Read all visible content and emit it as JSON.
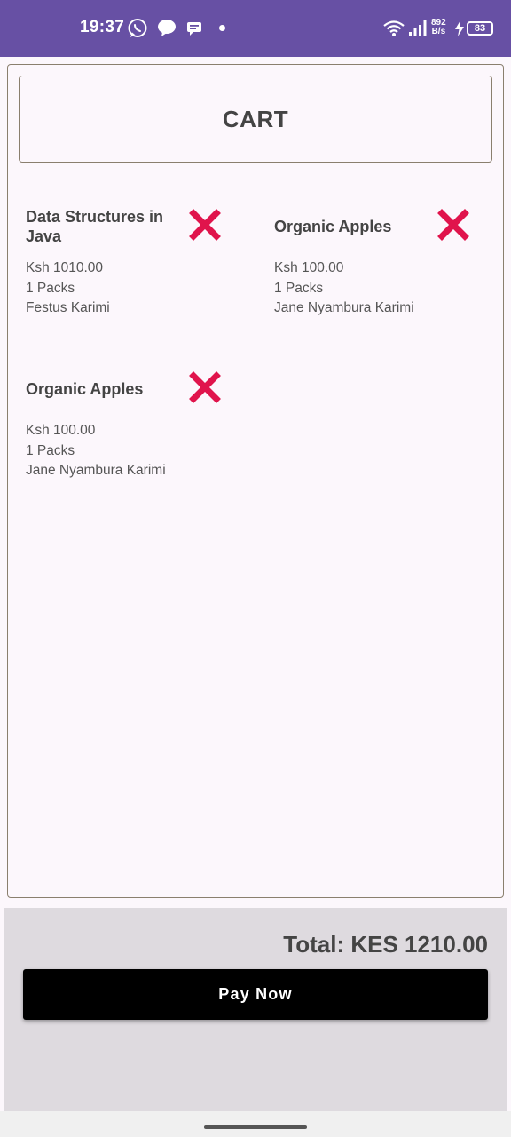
{
  "status_bar": {
    "time": "19:37",
    "net_speed_value": "892",
    "net_speed_unit": "B/s",
    "battery": "83",
    "icons": [
      "whatsapp-icon",
      "chat-bubble-icon",
      "message-icon",
      "notification-dot",
      "wifi-icon",
      "signal-icon",
      "charging-icon",
      "battery-icon"
    ]
  },
  "cart": {
    "title": "CART",
    "items": [
      {
        "name": "Data Structures in Java",
        "price": "Ksh 1010.00",
        "quantity": "1 Packs",
        "seller": "Festus Karimi",
        "remove_icon": "close-x-icon"
      },
      {
        "name": "Organic Apples",
        "price": "Ksh 100.00",
        "quantity": "1 Packs",
        "seller": "Jane Nyambura Karimi",
        "remove_icon": "close-x-icon"
      },
      {
        "name": "Organic Apples",
        "price": "Ksh 100.00",
        "quantity": "1 Packs",
        "seller": "Jane Nyambura Karimi",
        "remove_icon": "close-x-icon"
      }
    ]
  },
  "footer": {
    "total": "Total: KES 1210.00",
    "pay_label": "Pay Now"
  },
  "colors": {
    "status_bar": "#6750a4",
    "remove_icon": "#e0144c",
    "pay_button": "#000000",
    "bottom_panel": "#dedadf"
  }
}
